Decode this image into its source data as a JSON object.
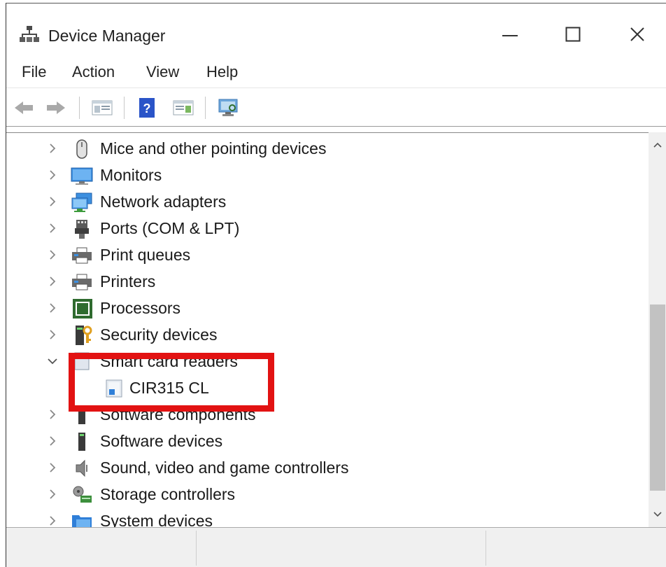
{
  "window": {
    "title": "Device Manager",
    "controls": {
      "minimize_icon": "minimize-icon",
      "maximize_icon": "maximize-icon",
      "close_icon": "close-icon"
    }
  },
  "menu": [
    "File",
    "Action",
    "View",
    "Help"
  ],
  "toolbar": [
    "back-arrow-icon",
    "forward-arrow-icon",
    "show-hide-console-tree-icon",
    "help-icon",
    "action-pane-icon",
    "scan-hardware-icon"
  ],
  "tree": {
    "items": [
      {
        "label": "Mice and other pointing devices",
        "icon": "mouse-icon",
        "expanded": false
      },
      {
        "label": "Monitors",
        "icon": "monitor-icon",
        "expanded": false
      },
      {
        "label": "Network adapters",
        "icon": "network-adapter-icon",
        "expanded": false
      },
      {
        "label": "Ports (COM & LPT)",
        "icon": "port-icon",
        "expanded": false
      },
      {
        "label": "Print queues",
        "icon": "printer-icon",
        "expanded": false
      },
      {
        "label": "Printers",
        "icon": "printer-icon",
        "expanded": false
      },
      {
        "label": "Processors",
        "icon": "processor-icon",
        "expanded": false
      },
      {
        "label": "Security devices",
        "icon": "security-device-icon",
        "expanded": false
      },
      {
        "label": "Smart card readers",
        "icon": "smart-card-reader-icon",
        "expanded": true,
        "obscured": true
      },
      {
        "label": "CIR315 CL",
        "icon": "smart-card-reader-icon",
        "child": true
      },
      {
        "label": "Software components",
        "icon": "software-component-icon",
        "expanded": false,
        "obscured": true
      },
      {
        "label": "Software devices",
        "icon": "software-device-icon",
        "expanded": false
      },
      {
        "label": "Sound, video and game controllers",
        "icon": "speaker-icon",
        "expanded": false
      },
      {
        "label": "Storage controllers",
        "icon": "storage-controller-icon",
        "expanded": false
      },
      {
        "label": "System devices",
        "icon": "system-folder-icon",
        "expanded": false
      }
    ]
  },
  "colors": {
    "highlight": "#e21212",
    "accent": "#1e78d7"
  }
}
